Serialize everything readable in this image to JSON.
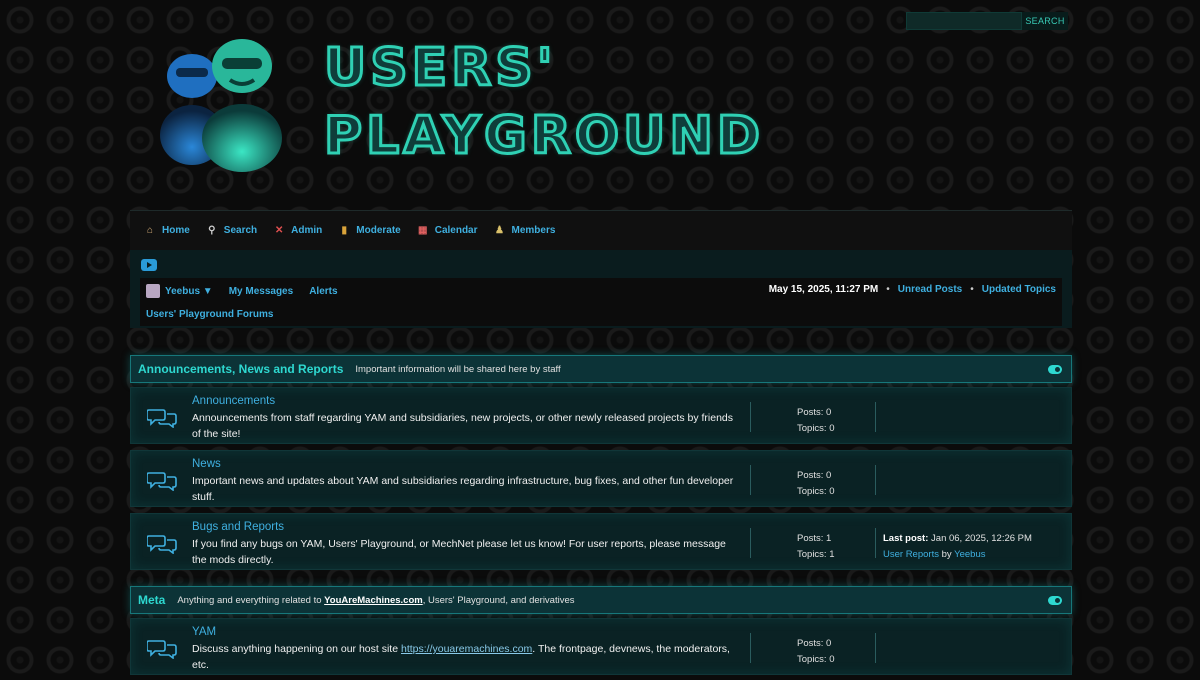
{
  "search": {
    "placeholder": "",
    "button_label": "SEARCH"
  },
  "logo": {
    "line1": "USERS'",
    "line2": "PLAYGROUND"
  },
  "nav": {
    "items": [
      {
        "label": "Home",
        "icon": "home-icon",
        "glyph": "⌂"
      },
      {
        "label": "Search",
        "icon": "search-icon",
        "glyph": "⚲"
      },
      {
        "label": "Admin",
        "icon": "admin-icon",
        "glyph": "✕"
      },
      {
        "label": "Moderate",
        "icon": "moderate-icon",
        "glyph": "▮"
      },
      {
        "label": "Calendar",
        "icon": "calendar-icon",
        "glyph": "▦"
      },
      {
        "label": "Members",
        "icon": "members-icon",
        "glyph": "♟"
      }
    ]
  },
  "userbar": {
    "username": "Yeebus ▼",
    "messages": "My Messages",
    "alerts": "Alerts",
    "datetime": "May 15, 2025, 11:27 PM",
    "unread": "Unread Posts",
    "updated": "Updated Topics",
    "separator": "•",
    "breadcrumb": "Users' Playground Forums"
  },
  "categories": [
    {
      "title": "Announcements, News and Reports",
      "desc": "Important information will be shared here by staff",
      "forums": [
        {
          "title": "Announcements",
          "desc": "Announcements from staff regarding YAM and subsidiaries, new projects, or other newly released projects by friends of the site!",
          "posts": "Posts: 0",
          "topics": "Topics: 0"
        },
        {
          "title": "News",
          "desc": "Important news and updates about YAM and subsidiaries regarding infrastructure, bug fixes, and other fun developer stuff.",
          "posts": "Posts: 0",
          "topics": "Topics: 0"
        },
        {
          "title": "Bugs and Reports",
          "desc": "If you find any bugs on YAM, Users' Playground, or MechNet please let us know! For user reports, please message the mods directly.",
          "posts": "Posts: 1",
          "topics": "Topics: 1",
          "last_post_label": "Last post:",
          "last_post_date": "Jan 06, 2025, 12:26 PM",
          "last_post_topic": "User Reports",
          "last_post_by": "by",
          "last_post_user": "Yeebus"
        }
      ]
    },
    {
      "title": "Meta",
      "desc_pre": "Anything and everything related to",
      "desc_link": "YouAreMachines.com",
      "desc_post": ", Users' Playground, and derivatives",
      "forums": [
        {
          "title": "YAM",
          "desc_pre": "Discuss anything happening on our host site",
          "desc_link": "https://youaremachines.com",
          "desc_post": ". The frontpage, devnews, the moderators, etc.",
          "posts": "Posts: 0",
          "topics": "Topics: 0"
        }
      ]
    }
  ],
  "colors": {
    "accent": "#2ed8d0",
    "link": "#3fb0e0",
    "background": "#0b0b0b"
  }
}
